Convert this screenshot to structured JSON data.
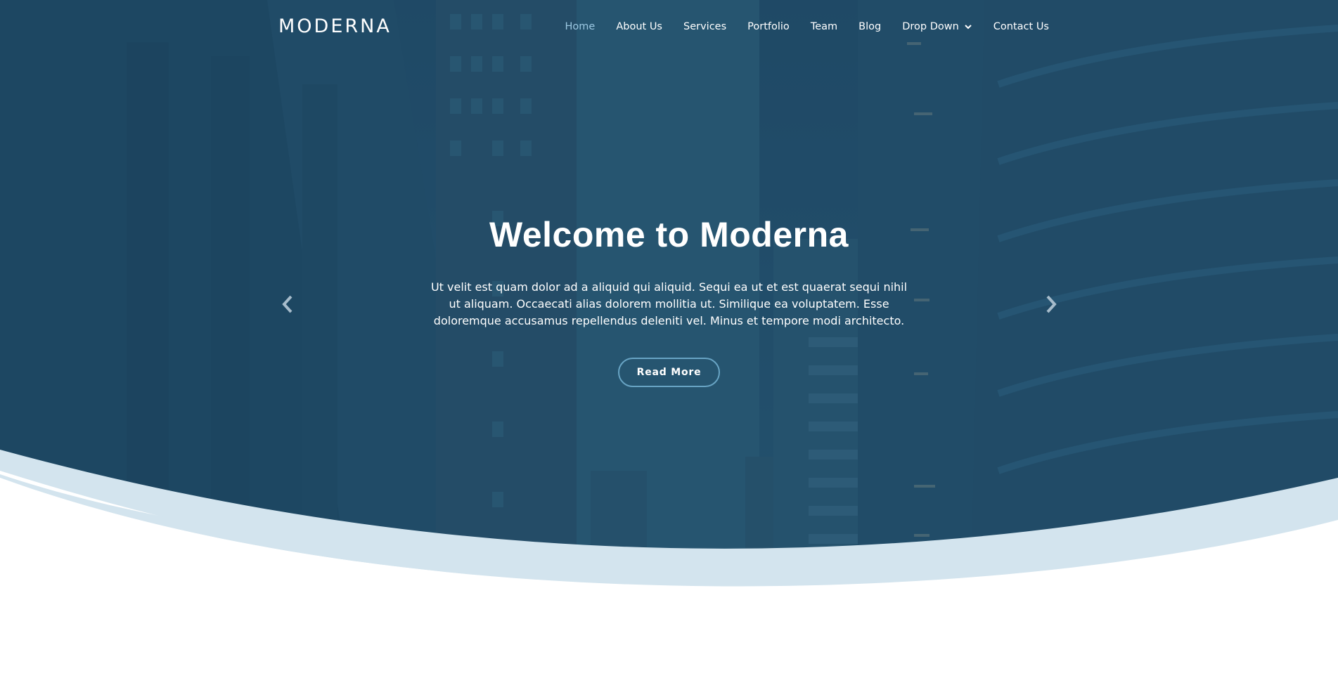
{
  "brand": {
    "logo": "MODERNA"
  },
  "nav": {
    "items": [
      {
        "label": "Home",
        "active": true
      },
      {
        "label": "About Us"
      },
      {
        "label": "Services"
      },
      {
        "label": "Portfolio"
      },
      {
        "label": "Team"
      },
      {
        "label": "Blog"
      },
      {
        "label": "Drop Down",
        "has_dropdown": true
      },
      {
        "label": "Contact Us"
      }
    ]
  },
  "hero": {
    "title": "Welcome to Moderna",
    "text": "Ut velit est quam dolor ad a aliquid qui aliquid. Sequi ea ut et est quaerat sequi nihil ut aliquam. Occaecati alias dolorem mollitia ut. Similique ea voluptatem. Esse doloremque accusamus repellendus deleniti vel. Minus et tempore modi architecto.",
    "cta_label": "Read More",
    "prev_icon": "chevron-left-icon",
    "next_icon": "chevron-right-icon"
  },
  "colors": {
    "hero_overlay": "#1f4a66",
    "accent": "#68a4c4",
    "active_nav": "#9cc8e2",
    "wave_light": "#d3e4ee"
  }
}
